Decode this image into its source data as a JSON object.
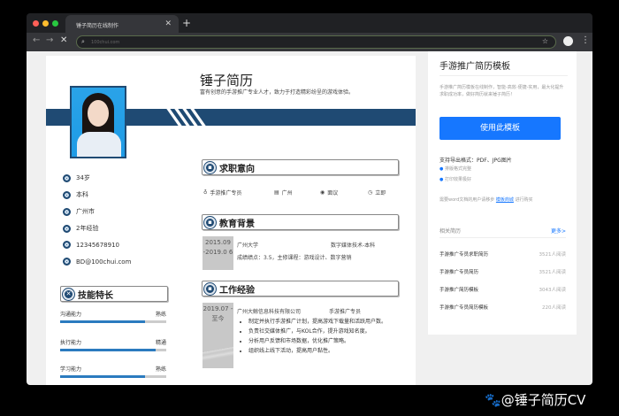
{
  "browser": {
    "tab_title": "锤子简历在线制作",
    "address": "100chui.com"
  },
  "resume": {
    "name": "锤子简历",
    "tagline": "富有创意的手游推广专业人才，致力于打造精彩纷呈的游戏体验。",
    "info": [
      {
        "icon": "age-icon",
        "text": "34岁"
      },
      {
        "icon": "education-icon",
        "text": "本科"
      },
      {
        "icon": "location-icon",
        "text": "广州市"
      },
      {
        "icon": "experience-icon",
        "text": "2年经验"
      },
      {
        "icon": "phone-icon",
        "text": "12345678910"
      },
      {
        "icon": "email-icon",
        "text": "BD@100chui.com"
      }
    ],
    "skills_title": "技能特长",
    "skills": [
      {
        "name": "沟通能力",
        "level": "熟练",
        "percent": 80
      },
      {
        "name": "执行能力",
        "level": "精通",
        "percent": 90
      },
      {
        "name": "学习能力",
        "level": "熟练",
        "percent": 80
      }
    ],
    "intent_title": "求职意向",
    "intent": [
      {
        "icon": "position-icon",
        "text": "手游推广专员"
      },
      {
        "icon": "city-icon",
        "text": "广州"
      },
      {
        "icon": "salary-icon",
        "text": "面议"
      },
      {
        "icon": "clock-icon",
        "text": "立即"
      }
    ],
    "edu_title": "教育背景",
    "edu": {
      "date": "2015.09 -2019.0 6",
      "school": "广州大学",
      "major": "数字媒体技术-本科",
      "detail": "成绩绩点：3.5，主修课程：游戏设计、数字营销"
    },
    "work_title": "工作经验",
    "work": {
      "date": "2019.07 -至今",
      "company": "广州大鲸信息科技有限公司",
      "role": "手游推广专员",
      "bullets": [
        "制定并执行手游推广计划，提高游戏下载量和活跃用户数。",
        "负责社交媒体推广，与KOL合作，提升游戏知名度。",
        "分析用户反馈和市场数据，优化推广策略。",
        "组织线上线下活动，提高用户黏性。"
      ]
    }
  },
  "side": {
    "title": "手游推广简历模板",
    "desc": "手游推广简历模板在线制作，智能-高效-便捷-实用，最大化提升求职成功率，做好简历就来锤子简历！",
    "use_button": "使用此模板",
    "formats": "支持导出格式：PDF、JPG图片",
    "features": [
      "排版格式完整",
      "打印效果极好"
    ],
    "word_note_pre": "需要word文档的用户请移步",
    "word_link": "模板商城",
    "word_note_post": "进行购买",
    "related_title": "相关简历",
    "more": "更多>",
    "related": [
      {
        "title": "手游推广专员求职简历",
        "reads": "3521人阅读"
      },
      {
        "title": "手游推广专员简历",
        "reads": "3521人阅读"
      },
      {
        "title": "手游推广简历模板",
        "reads": "3043人阅读"
      },
      {
        "title": "手游推广专员简历模板",
        "reads": "220人阅读"
      }
    ]
  },
  "watermark": "@锤子简历CV",
  "colors": {
    "brand": "#1f4a73",
    "button": "#1677ff",
    "skill_bar": "#2b7bbf"
  }
}
